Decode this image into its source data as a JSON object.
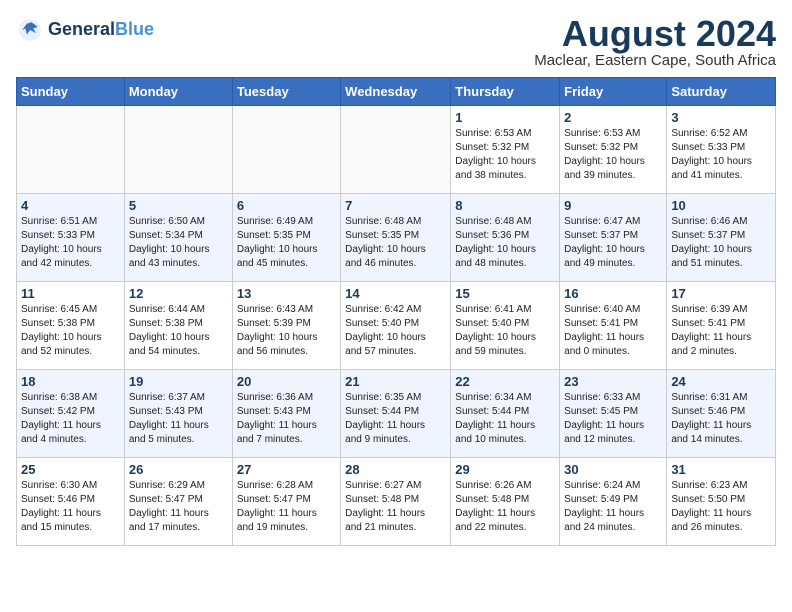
{
  "logo": {
    "line1": "General",
    "line2": "Blue"
  },
  "title": "August 2024",
  "location": "Maclear, Eastern Cape, South Africa",
  "days_of_week": [
    "Sunday",
    "Monday",
    "Tuesday",
    "Wednesday",
    "Thursday",
    "Friday",
    "Saturday"
  ],
  "weeks": [
    [
      {
        "day": "",
        "info": ""
      },
      {
        "day": "",
        "info": ""
      },
      {
        "day": "",
        "info": ""
      },
      {
        "day": "",
        "info": ""
      },
      {
        "day": "1",
        "info": "Sunrise: 6:53 AM\nSunset: 5:32 PM\nDaylight: 10 hours\nand 38 minutes."
      },
      {
        "day": "2",
        "info": "Sunrise: 6:53 AM\nSunset: 5:32 PM\nDaylight: 10 hours\nand 39 minutes."
      },
      {
        "day": "3",
        "info": "Sunrise: 6:52 AM\nSunset: 5:33 PM\nDaylight: 10 hours\nand 41 minutes."
      }
    ],
    [
      {
        "day": "4",
        "info": "Sunrise: 6:51 AM\nSunset: 5:33 PM\nDaylight: 10 hours\nand 42 minutes."
      },
      {
        "day": "5",
        "info": "Sunrise: 6:50 AM\nSunset: 5:34 PM\nDaylight: 10 hours\nand 43 minutes."
      },
      {
        "day": "6",
        "info": "Sunrise: 6:49 AM\nSunset: 5:35 PM\nDaylight: 10 hours\nand 45 minutes."
      },
      {
        "day": "7",
        "info": "Sunrise: 6:48 AM\nSunset: 5:35 PM\nDaylight: 10 hours\nand 46 minutes."
      },
      {
        "day": "8",
        "info": "Sunrise: 6:48 AM\nSunset: 5:36 PM\nDaylight: 10 hours\nand 48 minutes."
      },
      {
        "day": "9",
        "info": "Sunrise: 6:47 AM\nSunset: 5:37 PM\nDaylight: 10 hours\nand 49 minutes."
      },
      {
        "day": "10",
        "info": "Sunrise: 6:46 AM\nSunset: 5:37 PM\nDaylight: 10 hours\nand 51 minutes."
      }
    ],
    [
      {
        "day": "11",
        "info": "Sunrise: 6:45 AM\nSunset: 5:38 PM\nDaylight: 10 hours\nand 52 minutes."
      },
      {
        "day": "12",
        "info": "Sunrise: 6:44 AM\nSunset: 5:38 PM\nDaylight: 10 hours\nand 54 minutes."
      },
      {
        "day": "13",
        "info": "Sunrise: 6:43 AM\nSunset: 5:39 PM\nDaylight: 10 hours\nand 56 minutes."
      },
      {
        "day": "14",
        "info": "Sunrise: 6:42 AM\nSunset: 5:40 PM\nDaylight: 10 hours\nand 57 minutes."
      },
      {
        "day": "15",
        "info": "Sunrise: 6:41 AM\nSunset: 5:40 PM\nDaylight: 10 hours\nand 59 minutes."
      },
      {
        "day": "16",
        "info": "Sunrise: 6:40 AM\nSunset: 5:41 PM\nDaylight: 11 hours\nand 0 minutes."
      },
      {
        "day": "17",
        "info": "Sunrise: 6:39 AM\nSunset: 5:41 PM\nDaylight: 11 hours\nand 2 minutes."
      }
    ],
    [
      {
        "day": "18",
        "info": "Sunrise: 6:38 AM\nSunset: 5:42 PM\nDaylight: 11 hours\nand 4 minutes."
      },
      {
        "day": "19",
        "info": "Sunrise: 6:37 AM\nSunset: 5:43 PM\nDaylight: 11 hours\nand 5 minutes."
      },
      {
        "day": "20",
        "info": "Sunrise: 6:36 AM\nSunset: 5:43 PM\nDaylight: 11 hours\nand 7 minutes."
      },
      {
        "day": "21",
        "info": "Sunrise: 6:35 AM\nSunset: 5:44 PM\nDaylight: 11 hours\nand 9 minutes."
      },
      {
        "day": "22",
        "info": "Sunrise: 6:34 AM\nSunset: 5:44 PM\nDaylight: 11 hours\nand 10 minutes."
      },
      {
        "day": "23",
        "info": "Sunrise: 6:33 AM\nSunset: 5:45 PM\nDaylight: 11 hours\nand 12 minutes."
      },
      {
        "day": "24",
        "info": "Sunrise: 6:31 AM\nSunset: 5:46 PM\nDaylight: 11 hours\nand 14 minutes."
      }
    ],
    [
      {
        "day": "25",
        "info": "Sunrise: 6:30 AM\nSunset: 5:46 PM\nDaylight: 11 hours\nand 15 minutes."
      },
      {
        "day": "26",
        "info": "Sunrise: 6:29 AM\nSunset: 5:47 PM\nDaylight: 11 hours\nand 17 minutes."
      },
      {
        "day": "27",
        "info": "Sunrise: 6:28 AM\nSunset: 5:47 PM\nDaylight: 11 hours\nand 19 minutes."
      },
      {
        "day": "28",
        "info": "Sunrise: 6:27 AM\nSunset: 5:48 PM\nDaylight: 11 hours\nand 21 minutes."
      },
      {
        "day": "29",
        "info": "Sunrise: 6:26 AM\nSunset: 5:48 PM\nDaylight: 11 hours\nand 22 minutes."
      },
      {
        "day": "30",
        "info": "Sunrise: 6:24 AM\nSunset: 5:49 PM\nDaylight: 11 hours\nand 24 minutes."
      },
      {
        "day": "31",
        "info": "Sunrise: 6:23 AM\nSunset: 5:50 PM\nDaylight: 11 hours\nand 26 minutes."
      }
    ]
  ]
}
